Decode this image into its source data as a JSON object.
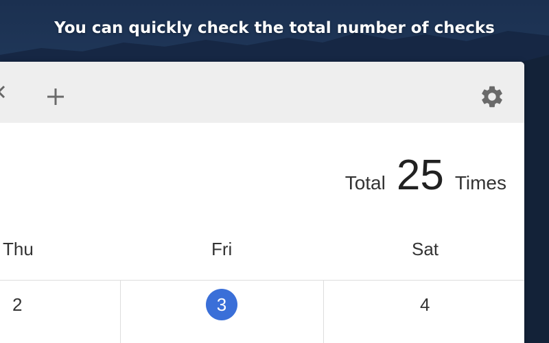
{
  "headline": "You can quickly check the total number of checks",
  "toolbar": {
    "back_icon": "chevron-left-icon",
    "add_icon": "plus-icon",
    "settings_icon": "gear-icon",
    "background": "#eeeeee"
  },
  "summary": {
    "label": "Total",
    "count": "25",
    "unit": "Times"
  },
  "calendar": {
    "weekdays": [
      "Thu",
      "Fri",
      "Sat"
    ],
    "days": [
      "2",
      "3",
      "4"
    ],
    "selected_day": "3",
    "accent_color": "#3a6fd8"
  }
}
